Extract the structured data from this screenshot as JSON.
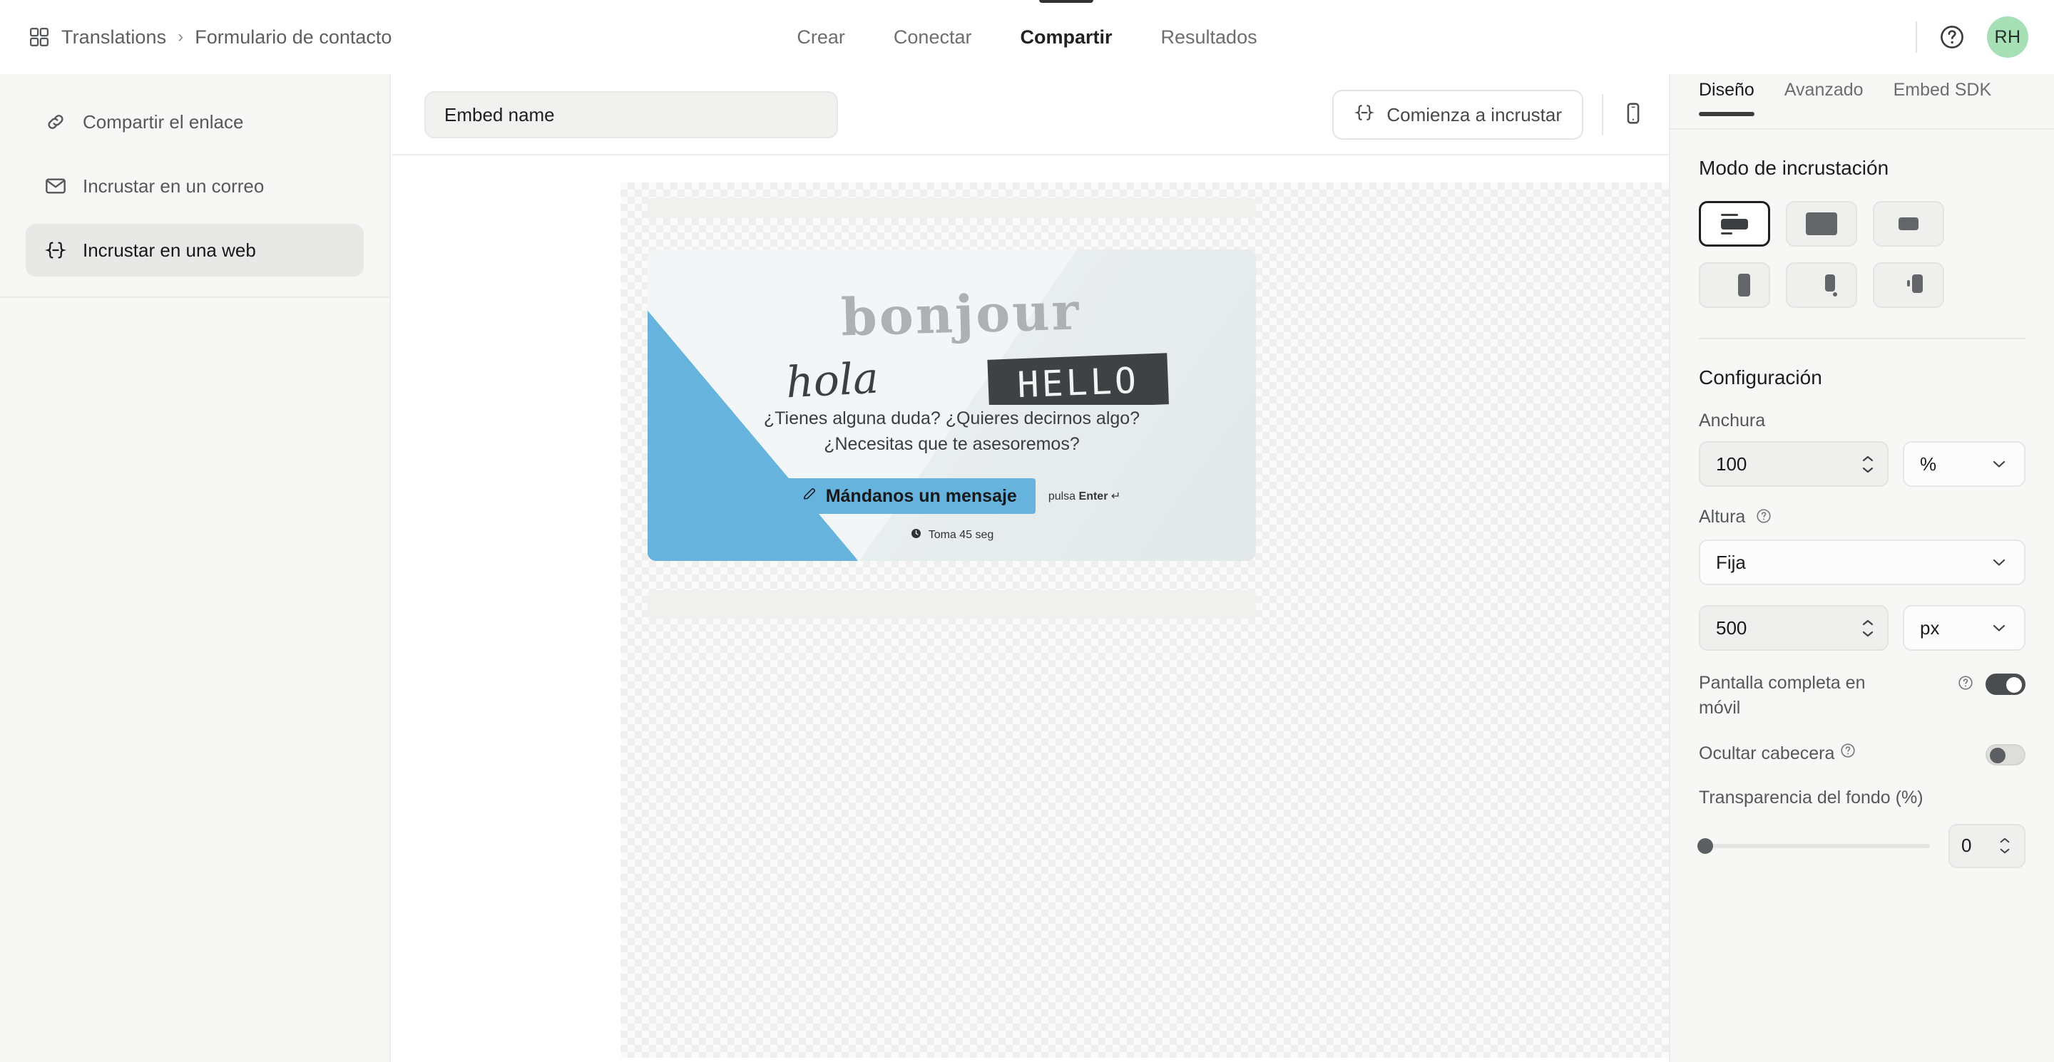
{
  "breadcrumb": {
    "icon": "grid-icon",
    "root": "Translations",
    "separator": "›",
    "current": "Formulario de contacto"
  },
  "main_tabs": [
    {
      "label": "Crear",
      "active": false
    },
    {
      "label": "Conectar",
      "active": false
    },
    {
      "label": "Compartir",
      "active": true
    },
    {
      "label": "Resultados",
      "active": false
    }
  ],
  "top_right": {
    "help_icon": "question-circle-icon",
    "avatar_initials": "RH",
    "avatar_color": "#a7e0b5"
  },
  "sidebar": {
    "items": [
      {
        "label": "Compartir el enlace",
        "icon": "link-icon",
        "active": false
      },
      {
        "label": "Incrustar en un correo",
        "icon": "mail-icon",
        "active": false
      },
      {
        "label": "Incrustar en una web",
        "icon": "code-brackets-icon",
        "active": true
      }
    ]
  },
  "toolbar": {
    "embed_name_value": "Embed name",
    "embed_name_placeholder": "Embed name",
    "start_embed_label": "Comienza a incrustar",
    "start_embed_icon": "code-brackets-icon",
    "mobile_preview_icon": "mobile-phone-icon"
  },
  "preview": {
    "hero_words": {
      "first": "bonjour",
      "second": "hola",
      "third": "HELLO"
    },
    "question": "¿Tienes alguna duda? ¿Quieres decirnos algo? ¿Necesitas que te asesoremos?",
    "cta_label": "Mándanos un mensaje",
    "cta_icon": "pencil-icon",
    "cta_color": "#66b3de",
    "hint_prefix": "pulsa ",
    "hint_key": "Enter",
    "hint_suffix": " ↵",
    "time_icon": "clock-icon",
    "time_label": "Toma 45 seg"
  },
  "right_panel": {
    "tabs": [
      {
        "label": "Diseño",
        "active": true
      },
      {
        "label": "Avanzado",
        "active": false
      },
      {
        "label": "Embed SDK",
        "active": false
      }
    ],
    "embed_mode": {
      "title": "Modo de incrustación",
      "options": [
        {
          "name": "inline-embed",
          "active": true
        },
        {
          "name": "fullpage-embed",
          "active": false
        },
        {
          "name": "popup-embed",
          "active": false
        },
        {
          "name": "slider-embed",
          "active": false
        },
        {
          "name": "popover-embed",
          "active": false
        },
        {
          "name": "side-tab-embed",
          "active": false
        }
      ]
    },
    "configuration": {
      "title": "Configuración",
      "width": {
        "label": "Anchura",
        "value": "100",
        "unit": "%"
      },
      "height": {
        "label": "Altura",
        "help_icon": "question-circle-icon",
        "mode": "Fija",
        "value": "500",
        "unit": "px"
      },
      "fullscreen_mobile": {
        "label": "Pantalla completa en móvil",
        "help_icon": "question-circle-icon",
        "enabled": true
      },
      "hide_header": {
        "label": "Ocultar cabecera",
        "help_icon": "question-circle-icon",
        "enabled": false
      },
      "background_transparency": {
        "label": "Transparencia del fondo (%)",
        "value": "0",
        "min": 0,
        "max": 100
      }
    }
  }
}
